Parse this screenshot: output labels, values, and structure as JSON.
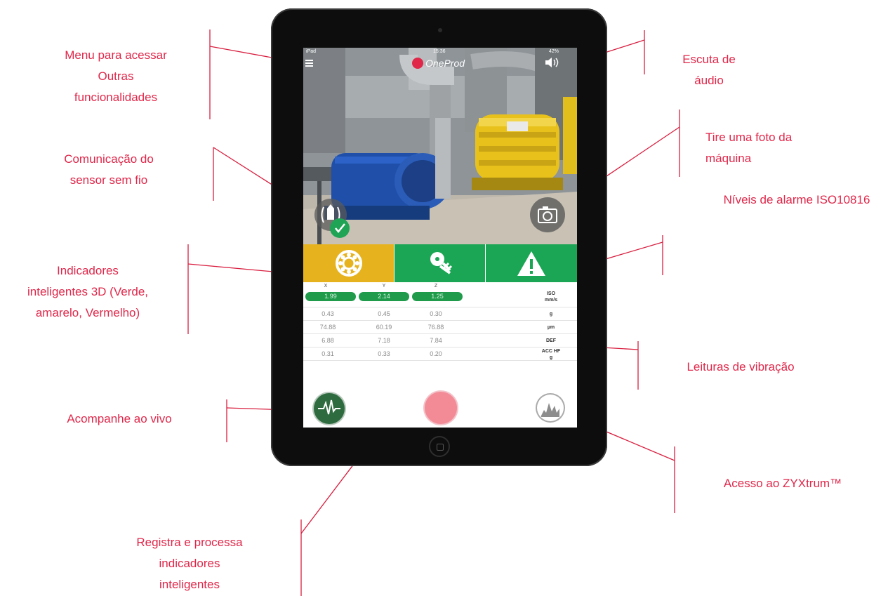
{
  "callouts": {
    "menu": [
      "Menu para acessar",
      "Outras",
      "funcionalidades"
    ],
    "wireless": [
      "Comunicação do",
      "sensor sem fio"
    ],
    "indicators": [
      "Indicadores",
      "inteligentes 3D (Verde,",
      "amarelo, Vermelho)"
    ],
    "live": [
      "Acompanhe ao vivo"
    ],
    "record": [
      "Registra e processa",
      "indicadores",
      "inteligentes"
    ],
    "audio": [
      "Escuta de áudio"
    ],
    "photo": [
      "Tire uma foto da",
      "máquina"
    ],
    "alarm": [
      "Níveis de alarme ISO10816"
    ],
    "vibration": [
      "Leituras de vibração"
    ],
    "zyxtrum": [
      "Acesso ao ZYXtrum™"
    ]
  },
  "app": {
    "status": {
      "left": "iPad",
      "time": "15:36",
      "right": "42%"
    },
    "brand": "OneProd",
    "tile_colors": [
      "#e6b31e",
      "#1aa654",
      "#1aa654"
    ],
    "icons": {
      "menu": "hamburger-icon",
      "audio": "speaker-icon",
      "camera": "camera-icon",
      "sensor": "wireless-sensor-icon",
      "check": "check-icon",
      "bearing": "bearing-icon",
      "unbalance": "unbalance-icon",
      "warning": "warning-icon",
      "live": "waveform-icon",
      "record": "record-icon",
      "spectrum": "spectrum-icon"
    },
    "table": {
      "headers": [
        "X",
        "Y",
        "Z"
      ],
      "iso": {
        "values": [
          "1.99",
          "2.14",
          "1.25"
        ],
        "unit": [
          "ISO",
          "mm/s"
        ]
      },
      "rows": [
        {
          "values": [
            "0.43",
            "0.45",
            "0.30"
          ],
          "unit": [
            "g"
          ]
        },
        {
          "values": [
            "74.88",
            "60.19",
            "76.88"
          ],
          "unit": [
            "µm"
          ]
        },
        {
          "values": [
            "6.88",
            "7.18",
            "7.84"
          ],
          "unit": [
            "DEF"
          ]
        },
        {
          "values": [
            "0.31",
            "0.33",
            "0.20"
          ],
          "unit": [
            "ACC HF",
            "g"
          ]
        }
      ]
    }
  }
}
